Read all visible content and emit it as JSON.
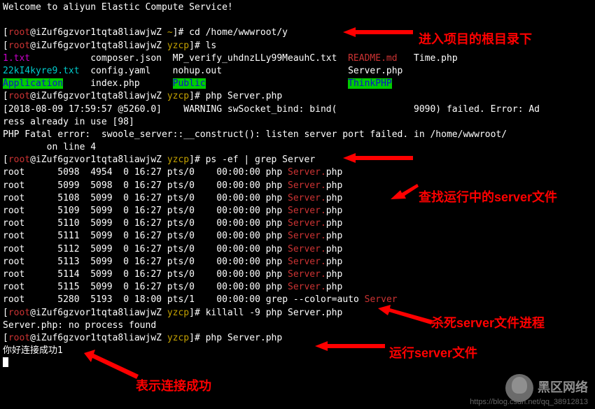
{
  "welcome": "Welcome to aliyun Elastic Compute Service!",
  "prompt": {
    "userhost_open": "[",
    "user": "root",
    "at": "@",
    "host": "iZuf6gzvor1tqta8liawjwZ",
    "tilde": "~",
    "dir": "yzcp",
    "close": "]#"
  },
  "cmd_cd": "cd /home/wwwroot/y",
  "cmd_ls": "ls",
  "ls": {
    "f1": "1.txt",
    "f2": "composer.json",
    "f3": "MP_verify_uhdnzLLy99MeauhC.txt",
    "f4": "README.md",
    "f5": "Time.php",
    "f6": "22kI4kyre9.txt",
    "f7": "config.yaml",
    "f8": "nohup.out",
    "f9": "Server.php",
    "f10": "Application",
    "f11": "index.php",
    "f12": "Public",
    "f13": "ThinkPHP"
  },
  "cmd_php1": "php Server.php",
  "warn_line": "[2018-08-09 17:59:57 @5260.0]    WARNING swSocket_bind: bind(              9090) failed. Error: Ad",
  "warn_line2": "ress already in use [98]",
  "fatal": "PHP Fatal error:  swoole_server::__construct(): listen server port failed. in /home/wwwroot/",
  "fatal2": "        on line 4",
  "cmd_ps": "ps -ef | grep Server",
  "ps_header_gap": "      ",
  "ps": [
    {
      "user": "root",
      "pid": "5098",
      "ppid": "4954",
      "c": "0",
      "stime": "16:27",
      "tty": "pts/0",
      "time": "00:00:00",
      "cmd": "php",
      "file": "Server.",
      "ext": "php"
    },
    {
      "user": "root",
      "pid": "5099",
      "ppid": "5098",
      "c": "0",
      "stime": "16:27",
      "tty": "pts/0",
      "time": "00:00:00",
      "cmd": "php",
      "file": "Server.",
      "ext": "php"
    },
    {
      "user": "root",
      "pid": "5108",
      "ppid": "5099",
      "c": "0",
      "stime": "16:27",
      "tty": "pts/0",
      "time": "00:00:00",
      "cmd": "php",
      "file": "Server.",
      "ext": "php"
    },
    {
      "user": "root",
      "pid": "5109",
      "ppid": "5099",
      "c": "0",
      "stime": "16:27",
      "tty": "pts/0",
      "time": "00:00:00",
      "cmd": "php",
      "file": "Server.",
      "ext": "php"
    },
    {
      "user": "root",
      "pid": "5110",
      "ppid": "5099",
      "c": "0",
      "stime": "16:27",
      "tty": "pts/0",
      "time": "00:00:00",
      "cmd": "php",
      "file": "Server.",
      "ext": "php"
    },
    {
      "user": "root",
      "pid": "5111",
      "ppid": "5099",
      "c": "0",
      "stime": "16:27",
      "tty": "pts/0",
      "time": "00:00:00",
      "cmd": "php",
      "file": "Server.",
      "ext": "php"
    },
    {
      "user": "root",
      "pid": "5112",
      "ppid": "5099",
      "c": "0",
      "stime": "16:27",
      "tty": "pts/0",
      "time": "00:00:00",
      "cmd": "php",
      "file": "Server.",
      "ext": "php"
    },
    {
      "user": "root",
      "pid": "5113",
      "ppid": "5099",
      "c": "0",
      "stime": "16:27",
      "tty": "pts/0",
      "time": "00:00:00",
      "cmd": "php",
      "file": "Server.",
      "ext": "php"
    },
    {
      "user": "root",
      "pid": "5114",
      "ppid": "5099",
      "c": "0",
      "stime": "16:27",
      "tty": "pts/0",
      "time": "00:00:00",
      "cmd": "php",
      "file": "Server.",
      "ext": "php"
    },
    {
      "user": "root",
      "pid": "5115",
      "ppid": "5099",
      "c": "0",
      "stime": "16:27",
      "tty": "pts/0",
      "time": "00:00:00",
      "cmd": "php",
      "file": "Server.",
      "ext": "php"
    }
  ],
  "ps_last": {
    "user": "root",
    "pid": "5280",
    "ppid": "5193",
    "c": "0",
    "stime": "18:00",
    "tty": "pts/1",
    "time": "00:00:00",
    "cmd": "grep --color=auto",
    "file": "Server"
  },
  "cmd_killall": "killall -9 php Server.php",
  "killall_out": "Server.php: no process found",
  "cmd_php2": "php Server.php",
  "success": "你好连接成功1",
  "annotations": {
    "a1": "进入项目的根目录下",
    "a2": "查找运行中的server文件",
    "a3": "杀死server文件进程",
    "a4": "运行server文件",
    "a5": "表示连接成功"
  },
  "watermark": "黑区网络",
  "url": "https://blog.csdn.net/qq_38912813"
}
